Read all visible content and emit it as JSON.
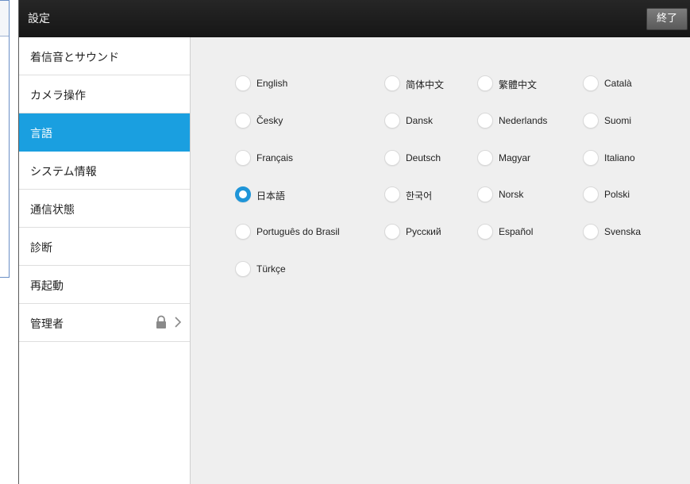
{
  "window": {
    "title": "設定",
    "done_label": "終了"
  },
  "colors": {
    "accent": "#1a9fe0",
    "titlebar": "#1e1e1e",
    "content_bg": "#efefef"
  },
  "sidebar": {
    "items": [
      {
        "label": "着信音とサウンド"
      },
      {
        "label": "カメラ操作"
      },
      {
        "label": "言語",
        "active": true
      },
      {
        "label": "システム情報"
      },
      {
        "label": "通信状態"
      },
      {
        "label": "診断"
      },
      {
        "label": "再起動"
      },
      {
        "label": "管理者",
        "icons": [
          "lock-icon",
          "chevron-right-icon"
        ]
      }
    ]
  },
  "languages": {
    "selected": "日本語",
    "rows": [
      [
        "English",
        "简体中文",
        "繁體中文",
        "Català"
      ],
      [
        "Česky",
        "Dansk",
        "Nederlands",
        "Suomi"
      ],
      [
        "Français",
        "Deutsch",
        "Magyar",
        "Italiano"
      ],
      [
        "日本語",
        "한국어",
        "Norsk",
        "Polski"
      ],
      [
        "Português do Brasil",
        "Русский",
        "Español",
        "Svenska"
      ],
      [
        "Türkçe"
      ]
    ]
  }
}
